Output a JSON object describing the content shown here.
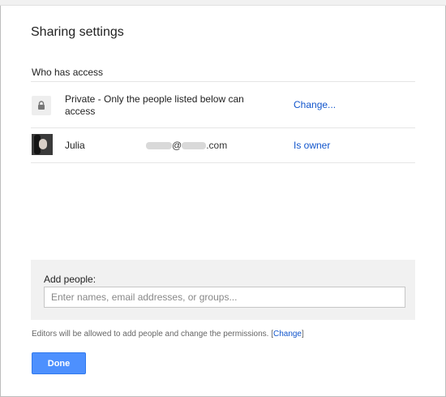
{
  "dialog": {
    "title": "Sharing settings",
    "who_has_access_label": "Who has access"
  },
  "access": {
    "icon": "lock-icon",
    "description": "Private - Only the people listed below can access",
    "change_link": "Change..."
  },
  "users": [
    {
      "name": "Julia",
      "email_domain_suffix": ".com",
      "email_at": "@",
      "role_link": "Is owner"
    }
  ],
  "add_people": {
    "label": "Add people:",
    "placeholder": "Enter names, email addresses, or groups..."
  },
  "editors_note": {
    "text": "Editors will be allowed to add people and change the permissions.",
    "bracket_open": "[",
    "change_link": "Change",
    "bracket_close": "]"
  },
  "done_button": "Done",
  "colors": {
    "link": "#1155cc",
    "primary_button": "#4d90fe",
    "panel_bg": "#f1f1f1"
  }
}
